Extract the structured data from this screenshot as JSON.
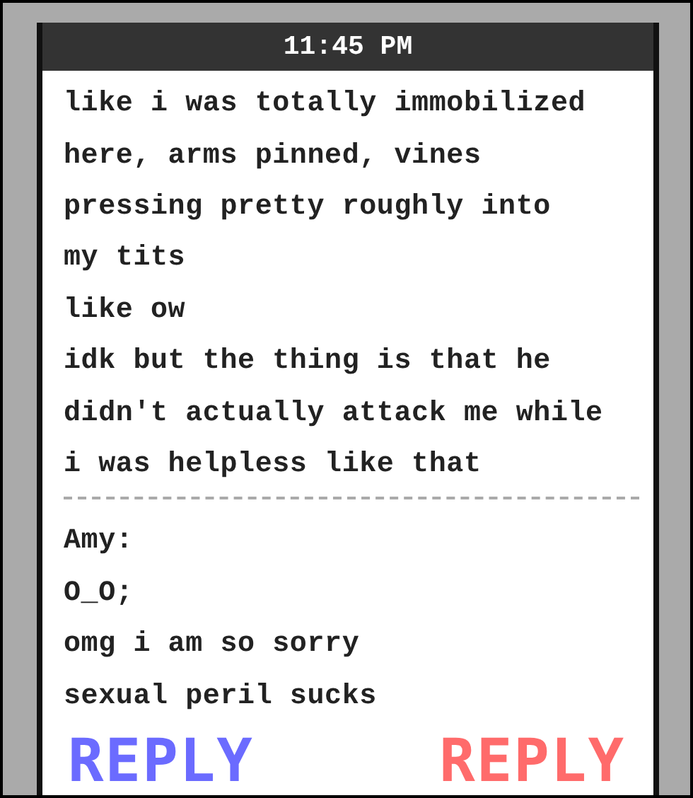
{
  "status_bar": {
    "time": "11:45 PM"
  },
  "messages": [
    {
      "lines": [
        "like i was totally immobilized",
        "here, arms pinned, vines",
        "pressing pretty roughly into",
        "my tits",
        "like ow",
        "idk but the thing is that he",
        "didn't actually attack me while",
        "i was helpless like that"
      ]
    },
    {
      "sender": "Amy:",
      "lines": [
        "O_O;",
        "omg i am so sorry",
        "sexual peril sucks"
      ]
    }
  ],
  "reply_buttons": [
    {
      "label": "REPLY",
      "color": "#6b6bff"
    },
    {
      "label": "REPLY",
      "color": "#ff6b6b"
    }
  ]
}
